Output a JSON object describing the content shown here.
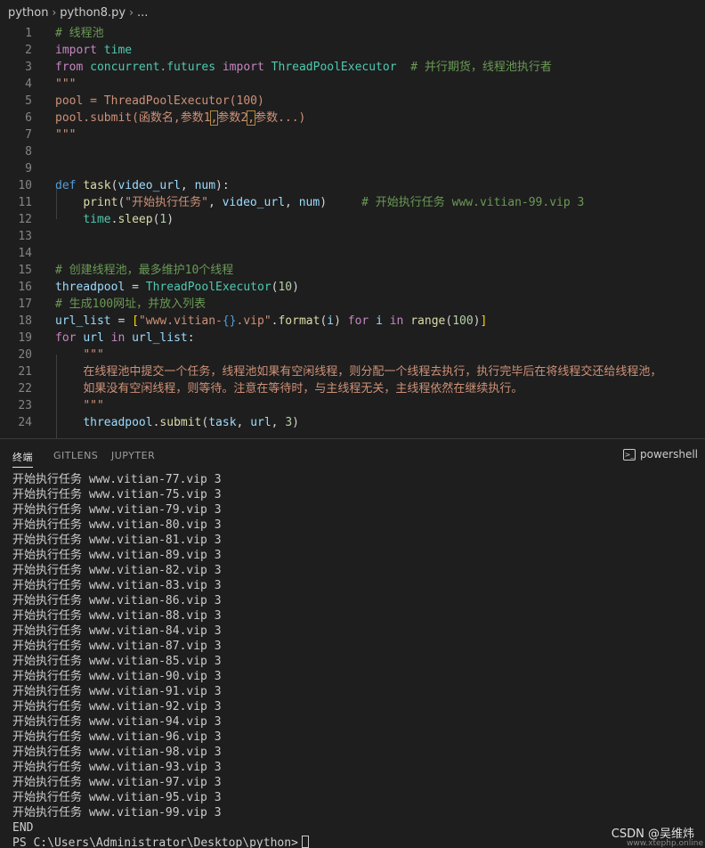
{
  "breadcrumb": {
    "folder": "python",
    "file": "python8.py",
    "more": "..."
  },
  "editor": {
    "ln": [
      "1",
      "2",
      "3",
      "4",
      "5",
      "6",
      "7",
      "8",
      "9",
      "10",
      "11",
      "12",
      "13",
      "14",
      "15",
      "16",
      "17",
      "18",
      "19",
      "20",
      "21",
      "22",
      "23",
      "24"
    ],
    "l1": "# 线程池",
    "l2_kw": "import",
    "l2_mod": "time",
    "l3_kw1": "from",
    "l3_mod": "concurrent.futures",
    "l3_kw2": "import",
    "l3_cls": "ThreadPoolExecutor",
    "l3_cmt": "# 并行期货，线程池执行者",
    "l4": "\"\"\"",
    "l5_a": "pool = ThreadPoolExecutor(100)",
    "l6_a": "pool.submit(函数名,参数1",
    "l6_b": ",",
    "l6_c": "参数2",
    "l6_d": ",",
    "l6_e": "参数...)",
    "l7": "\"\"\"",
    "l10_def": "def",
    "l10_fn": "task",
    "l10_p1": "(",
    "l10_a1": "video_url",
    "l10_c": ", ",
    "l10_a2": "num",
    "l10_p2": "):",
    "l11_fn": "print",
    "l11_p1": "(",
    "l11_str": "\"开始执行任务\"",
    "l11_c1": ", ",
    "l11_a1": "video_url",
    "l11_c2": ", ",
    "l11_a2": "num",
    "l11_p2": ")",
    "l11_cmt": "# 开始执行任务 www.vitian-99.vip 3",
    "l12_mod": "time",
    "l12_dot": ".",
    "l12_fn": "sleep",
    "l12_p1": "(",
    "l12_num": "1",
    "l12_p2": ")",
    "l15_cmt": "# 创建线程池，最多维护10个线程",
    "l16_var": "threadpool",
    "l16_eq": " = ",
    "l16_cls": "ThreadPoolExecutor",
    "l16_p1": "(",
    "l16_num": "10",
    "l16_p2": ")",
    "l17_cmt": "# 生成100网址，并放入列表",
    "l18_var": "url_list",
    "l18_eq": " = ",
    "l18_b1": "[",
    "l18_s1": "\"www.vitian-",
    "l18_s2": "{}",
    "l18_s3": ".vip\"",
    "l18_dot": ".",
    "l18_fn": "format",
    "l18_p1": "(",
    "l18_i": "i",
    "l18_p2": ")",
    "l18_for": "for",
    "l18_i2": "i",
    "l18_in": "in",
    "l18_range": "range",
    "l18_p3": "(",
    "l18_num": "100",
    "l18_p4": ")",
    "l18_b2": "]",
    "l19_for": "for",
    "l19_var": "url",
    "l19_in": "in",
    "l19_list": "url_list",
    "l19_colon": ":",
    "l20": "\"\"\"",
    "l21": "在线程池中提交一个任务，线程池如果有空闲线程，则分配一个线程去执行，执行完毕后在将线程交还给线程池，",
    "l22": "如果没有空闲线程，则等待。注意在等待时，与主线程无关，主线程依然在继续执行。",
    "l23": "\"\"\"",
    "l24_var": "threadpool",
    "l24_dot": ".",
    "l24_fn": "submit",
    "l24_p1": "(",
    "l24_a1": "task",
    "l24_c1": ", ",
    "l24_a2": "url",
    "l24_c2": ", ",
    "l24_num": "3",
    "l24_p2": ")"
  },
  "panel": {
    "tabs": [
      "终端",
      "GITLENS",
      "JUPYTER"
    ],
    "shell": "powershell",
    "output": [
      "开始执行任务 www.vitian-77.vip 3",
      "开始执行任务 www.vitian-75.vip 3",
      "开始执行任务 www.vitian-79.vip 3",
      "开始执行任务 www.vitian-80.vip 3",
      "开始执行任务 www.vitian-81.vip 3",
      "开始执行任务 www.vitian-89.vip 3",
      "开始执行任务 www.vitian-82.vip 3",
      "开始执行任务 www.vitian-83.vip 3",
      "开始执行任务 www.vitian-86.vip 3",
      "开始执行任务 www.vitian-88.vip 3",
      "开始执行任务 www.vitian-84.vip 3",
      "开始执行任务 www.vitian-87.vip 3",
      "开始执行任务 www.vitian-85.vip 3",
      "开始执行任务 www.vitian-90.vip 3",
      "开始执行任务 www.vitian-91.vip 3",
      "开始执行任务 www.vitian-92.vip 3",
      "开始执行任务 www.vitian-94.vip 3",
      "开始执行任务 www.vitian-96.vip 3",
      "开始执行任务 www.vitian-98.vip 3",
      "开始执行任务 www.vitian-93.vip 3",
      "开始执行任务 www.vitian-97.vip 3",
      "开始执行任务 www.vitian-95.vip 3",
      "开始执行任务 www.vitian-99.vip 3",
      "END"
    ],
    "prompt": "PS C:\\Users\\Administrator\\Desktop\\python>"
  },
  "watermark": "CSDN @吴维炜",
  "watermark2": "www.xtephp.online",
  "icons": {
    "chevron": "chevron-right-icon",
    "terminal": "terminal-icon"
  }
}
